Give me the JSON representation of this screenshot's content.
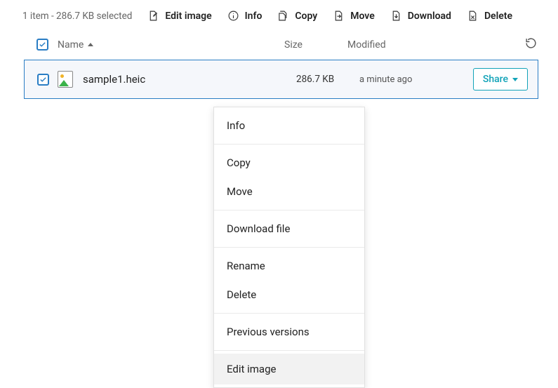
{
  "selection_info": "1 item - 286.7 KB selected",
  "toolbar": {
    "edit_image": "Edit image",
    "info": "Info",
    "copy": "Copy",
    "move": "Move",
    "download": "Download",
    "delete": "Delete"
  },
  "headers": {
    "name": "Name",
    "size": "Size",
    "modified": "Modified"
  },
  "file": {
    "name": "sample1.heic",
    "size": "286.7 KB",
    "modified": "a minute ago",
    "share": "Share"
  },
  "context_menu": {
    "info": "Info",
    "copy": "Copy",
    "move": "Move",
    "download_file": "Download file",
    "rename": "Rename",
    "delete": "Delete",
    "previous_versions": "Previous versions",
    "edit_image": "Edit image"
  }
}
